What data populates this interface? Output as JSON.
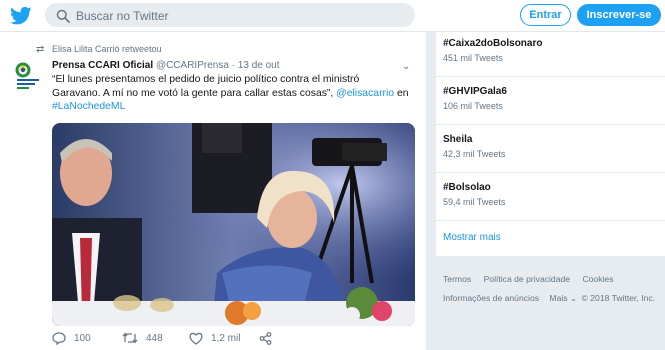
{
  "topbar": {
    "search_placeholder": "Buscar no Twitter",
    "login_label": "Entrar",
    "signup_label": "Inscrever-se"
  },
  "tweet": {
    "retweet_by": "Elisa Lilita Carrió retweetou",
    "author_name": "Prensa CCARI Oficial",
    "author_handle": "@CCARIPrensa",
    "separator": "·",
    "date": "13 de out",
    "text_line1": "“El lunes presentamos el pedido de juicio político contra el ministró",
    "text_line2_a": "Garavano. A mí no me votó la gente para callar estas cosas”, ",
    "text_mention": "@elisacarrio",
    "text_line2_b": " en",
    "text_hashtag": "#LaNochedeML",
    "replies": "100",
    "retweets": "448",
    "likes": "1,2 mil"
  },
  "trends": [
    {
      "name": "#Caixa2doBolsonaro",
      "count": "451 mil Tweets"
    },
    {
      "name": "#GHVIPGala6",
      "count": "106 mil Tweets"
    },
    {
      "name": "Sheila",
      "count": "42,3 mil Tweets"
    },
    {
      "name": "#Bolsolao",
      "count": "59,4 mil Tweets"
    }
  ],
  "show_more": "Mostrar mais",
  "footer": {
    "terms": "Termos",
    "privacy": "Política de privacidade",
    "cookies": "Cookies",
    "ads_info": "Informações de anúncios",
    "more": "Mais ⌄",
    "copyright": "© 2018 Twitter, Inc."
  },
  "colors": {
    "brand": "#1da1f2",
    "link": "#1b95e0",
    "background": "#e6ecf0"
  }
}
